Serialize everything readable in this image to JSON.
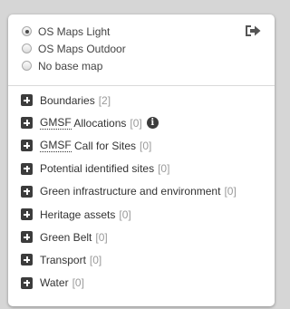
{
  "basemaps": {
    "options": [
      {
        "label": "OS Maps Light",
        "checked": true
      },
      {
        "label": "OS Maps Outdoor",
        "checked": false
      },
      {
        "label": "No base map",
        "checked": false
      }
    ],
    "collapse_icon": "sign-out-icon"
  },
  "layers": [
    {
      "label": "Boundaries",
      "count": "[2]"
    },
    {
      "label_abbr": "GMSF",
      "label_rest": " Allocations",
      "count": "[0]",
      "info_icon": "i"
    },
    {
      "label_abbr": "GMSF",
      "label_rest": " Call for Sites",
      "count": "[0]"
    },
    {
      "label": "Potential identified sites",
      "count": "[0]"
    },
    {
      "label": "Green infrastructure and environment",
      "count": "[0]"
    },
    {
      "label": "Heritage assets",
      "count": "[0]"
    },
    {
      "label": "Green Belt",
      "count": "[0]"
    },
    {
      "label": "Transport",
      "count": "[0]"
    },
    {
      "label": "Water",
      "count": "[0]"
    }
  ],
  "colors": {
    "expand_icon": "#3c3c3c",
    "count_text": "#9a9a9a"
  }
}
